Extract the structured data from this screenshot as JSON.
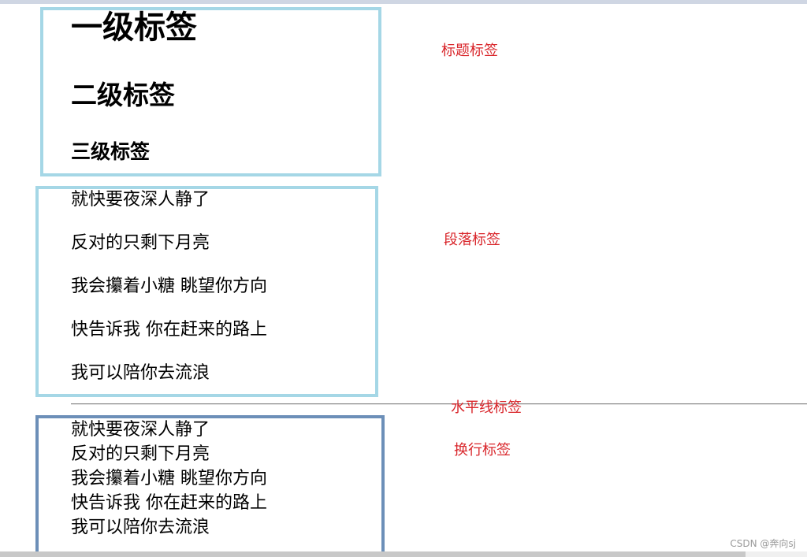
{
  "headings": {
    "h1": "一级标签",
    "h2": "二级标签",
    "h3": "三级标签"
  },
  "paragraphs": [
    "就快要夜深人静了",
    "反对的只剩下月亮",
    "我会攥着小糖 眺望你方向",
    "快告诉我 你在赶来的路上",
    "我可以陪你去流浪"
  ],
  "line_breaks": [
    "就快要夜深人静了",
    "反对的只剩下月亮",
    "我会攥着小糖 眺望你方向",
    "快告诉我 你在赶来的路上",
    "我可以陪你去流浪"
  ],
  "annotations": {
    "headings_label": "标题标签",
    "paragraphs_label": "段落标签",
    "hr_label": "水平线标签",
    "br_label": "换行标签"
  },
  "watermark": "CSDN @奔向sj",
  "colors": {
    "box_light": "#a5d7e6",
    "box_dark": "#6c8fb8",
    "annotation_red": "#d9262b"
  }
}
